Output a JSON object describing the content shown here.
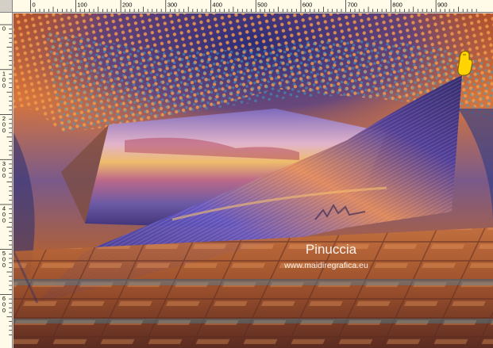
{
  "ruler": {
    "top_labels": [
      "0",
      "100",
      "200",
      "300",
      "400",
      "500",
      "600",
      "700",
      "800",
      "900"
    ],
    "left_labels": [
      "0",
      "100",
      "200",
      "300",
      "400",
      "500",
      "600"
    ]
  },
  "watermark": {
    "name": "Pinuccia",
    "url": "www.maidiregrafica.eu"
  },
  "colors": {
    "ruler_bg": "#fffbe8",
    "frame": "#d4d0c8",
    "orange": "#e0783a",
    "deep_blue": "#2a2a7a",
    "cursor": "#ffd400"
  },
  "icons": {
    "cursor": "pointing-hand-cursor-icon"
  }
}
